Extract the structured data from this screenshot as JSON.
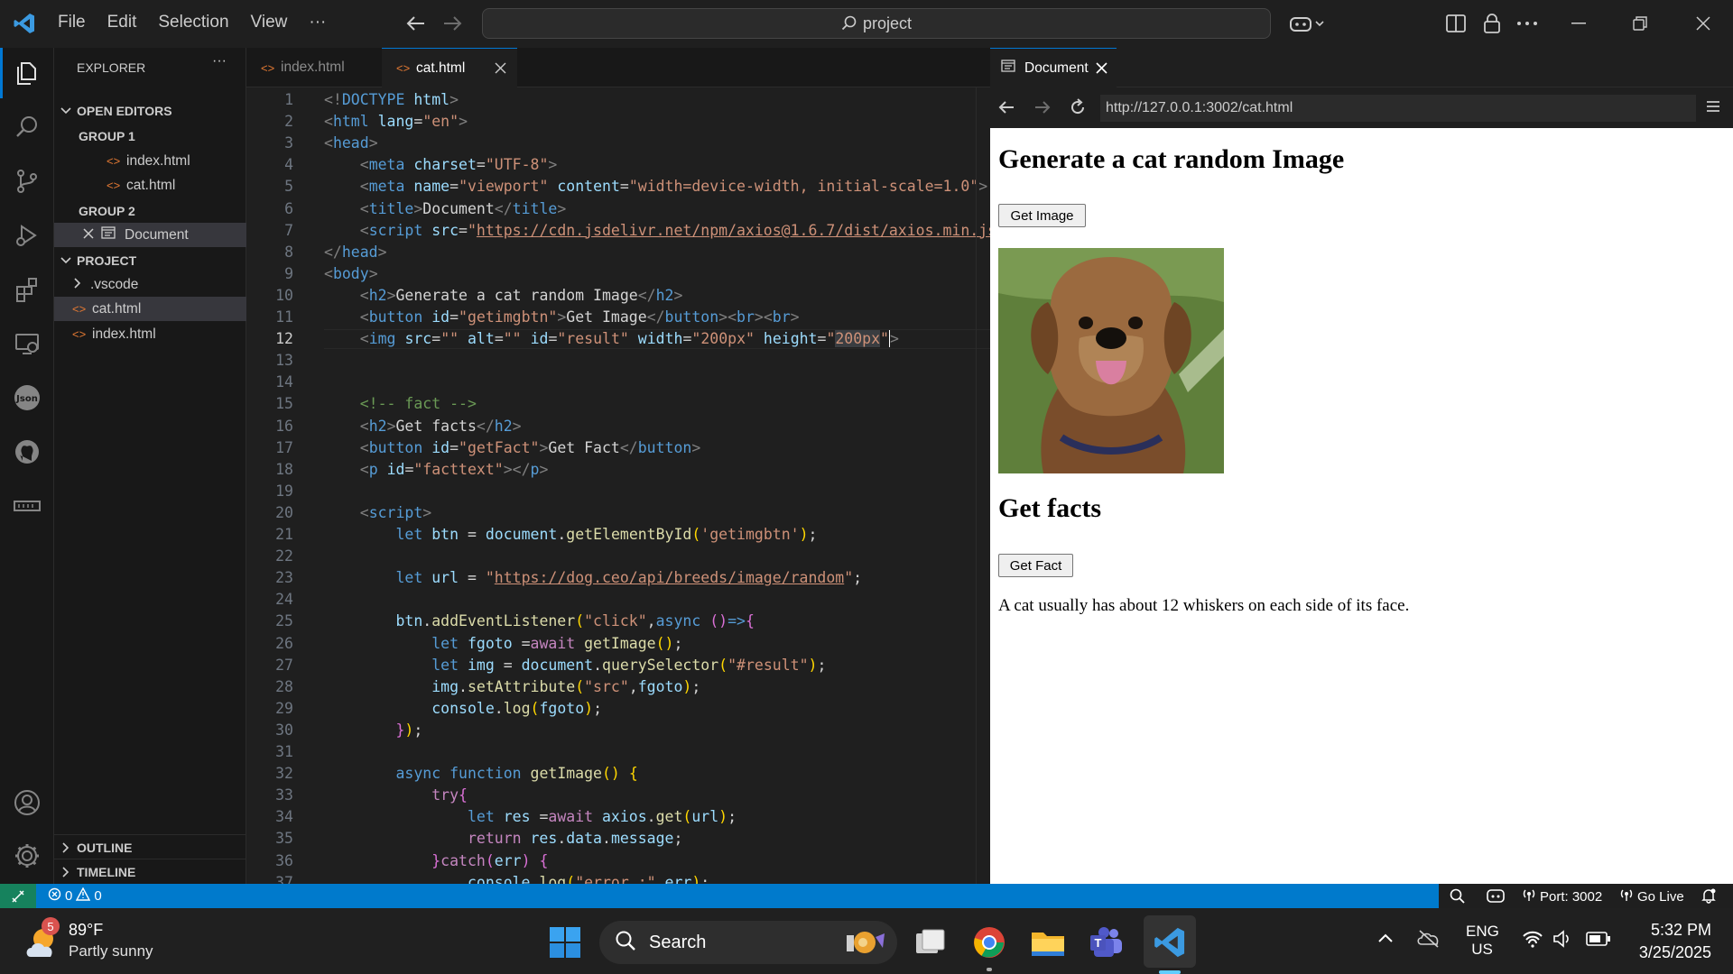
{
  "titlebar": {
    "menus": [
      "File",
      "Edit",
      "Selection",
      "View",
      "···"
    ],
    "search_text": "project"
  },
  "sidebar": {
    "title": "EXPLORER",
    "more": "···",
    "open_editors": "OPEN EDITORS",
    "group1": "GROUP 1",
    "group1_files": [
      "index.html",
      "cat.html"
    ],
    "group2": "GROUP 2",
    "group2_files": [
      "Document"
    ],
    "project": "PROJECT",
    "project_items": [
      ".vscode",
      "cat.html",
      "index.html"
    ],
    "outline": "OUTLINE",
    "timeline": "TIMELINE"
  },
  "editor": {
    "tabs": [
      "index.html",
      "cat.html"
    ],
    "active_tab": "cat.html",
    "current_line": 12,
    "first_line": 1,
    "last_line": 37
  },
  "browser": {
    "tab_title": "Document",
    "url": "http://127.0.0.1:3002/cat.html",
    "heading1": "Generate a cat random Image",
    "button1": "Get Image",
    "heading2": "Get facts",
    "button2": "Get Fact",
    "fact": "A cat usually has about 12 whiskers on each side of its face."
  },
  "statusbar": {
    "errors": "0",
    "warnings": "0",
    "port": "Port: 3002",
    "golive": "Go Live"
  },
  "taskbar": {
    "weather_badge": "5",
    "temperature": "89°F",
    "weather": "Partly sunny",
    "search": "Search",
    "lang1": "ENG",
    "lang2": "US",
    "time": "5:32 PM",
    "date": "3/25/2025"
  },
  "colors": {
    "accent": "#007acc",
    "editor_bg": "#1f1f1f",
    "sidebar_bg": "#181818"
  }
}
